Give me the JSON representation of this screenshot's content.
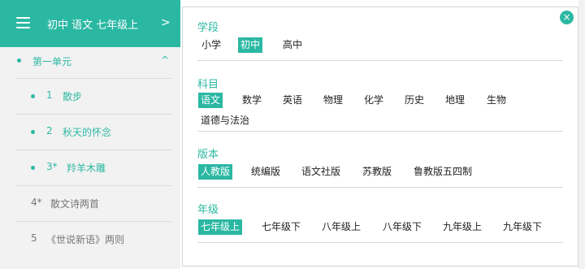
{
  "header": {
    "title": "初中 语文 七年级上",
    "arrow": ">"
  },
  "unit": {
    "label": "第一单元",
    "caret": "^"
  },
  "lessons": [
    {
      "num": "1",
      "title": "散步",
      "active": true
    },
    {
      "num": "2",
      "title": "秋天的怀念",
      "active": true
    },
    {
      "num": "3*",
      "title": "羚羊木雕",
      "active": true
    },
    {
      "num": "4*",
      "title": "散文诗两首",
      "active": false
    },
    {
      "num": "5",
      "title": "《世说新语》两则",
      "active": false
    }
  ],
  "panel": {
    "close": "×",
    "sections": [
      {
        "title": "学段",
        "options": [
          "小学",
          "初中",
          "高中"
        ],
        "selected": "初中"
      },
      {
        "title": "科目",
        "options": [
          "语文",
          "数学",
          "英语",
          "物理",
          "化学",
          "历史",
          "地理",
          "生物",
          "道德与法治"
        ],
        "selected": "语文"
      },
      {
        "title": "版本",
        "options": [
          "人教版",
          "统编版",
          "语文社版",
          "苏教版",
          "鲁教版五四制"
        ],
        "selected": "人教版"
      },
      {
        "title": "年级",
        "options": [
          "七年级上",
          "七年级下",
          "八年级上",
          "八年级下",
          "九年级上",
          "九年级下"
        ],
        "selected": "七年级上"
      }
    ]
  },
  "colors": {
    "accent": "#2bb8a3"
  }
}
